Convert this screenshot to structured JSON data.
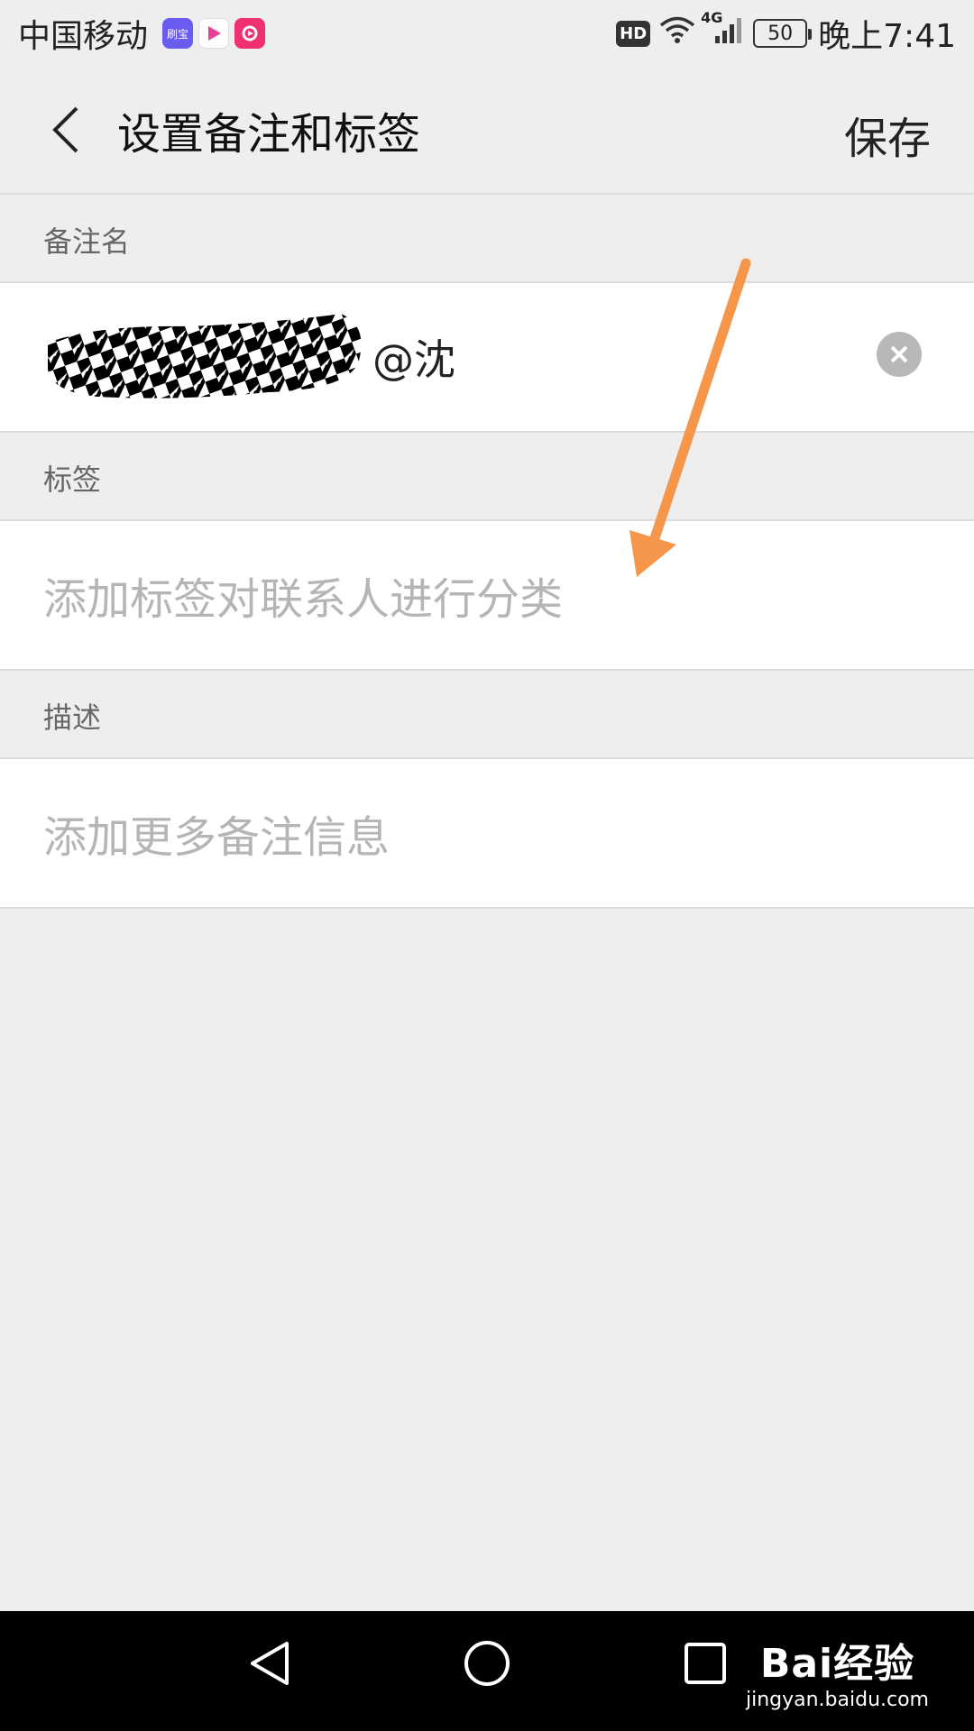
{
  "status_bar": {
    "carrier": "中国移动",
    "app_icons": [
      "刷宝",
      "play-icon",
      "video-icon"
    ],
    "hd": "HD",
    "network": "4G",
    "battery": "50",
    "time": "晚上7:41"
  },
  "header": {
    "title": "设置备注和标签",
    "save_label": "保存"
  },
  "sections": {
    "remark_label": "备注名",
    "remark_value_suffix": "@沈",
    "tag_label": "标签",
    "tag_placeholder": "添加标签对联系人进行分类",
    "description_label": "描述",
    "description_placeholder": "添加更多备注信息"
  },
  "watermark": {
    "logo": "Bai经验",
    "url": "jingyan.baidu.com"
  },
  "colors": {
    "background": "#eeeeee",
    "arrow": "#f5964a",
    "placeholder": "#b5b5b5"
  }
}
